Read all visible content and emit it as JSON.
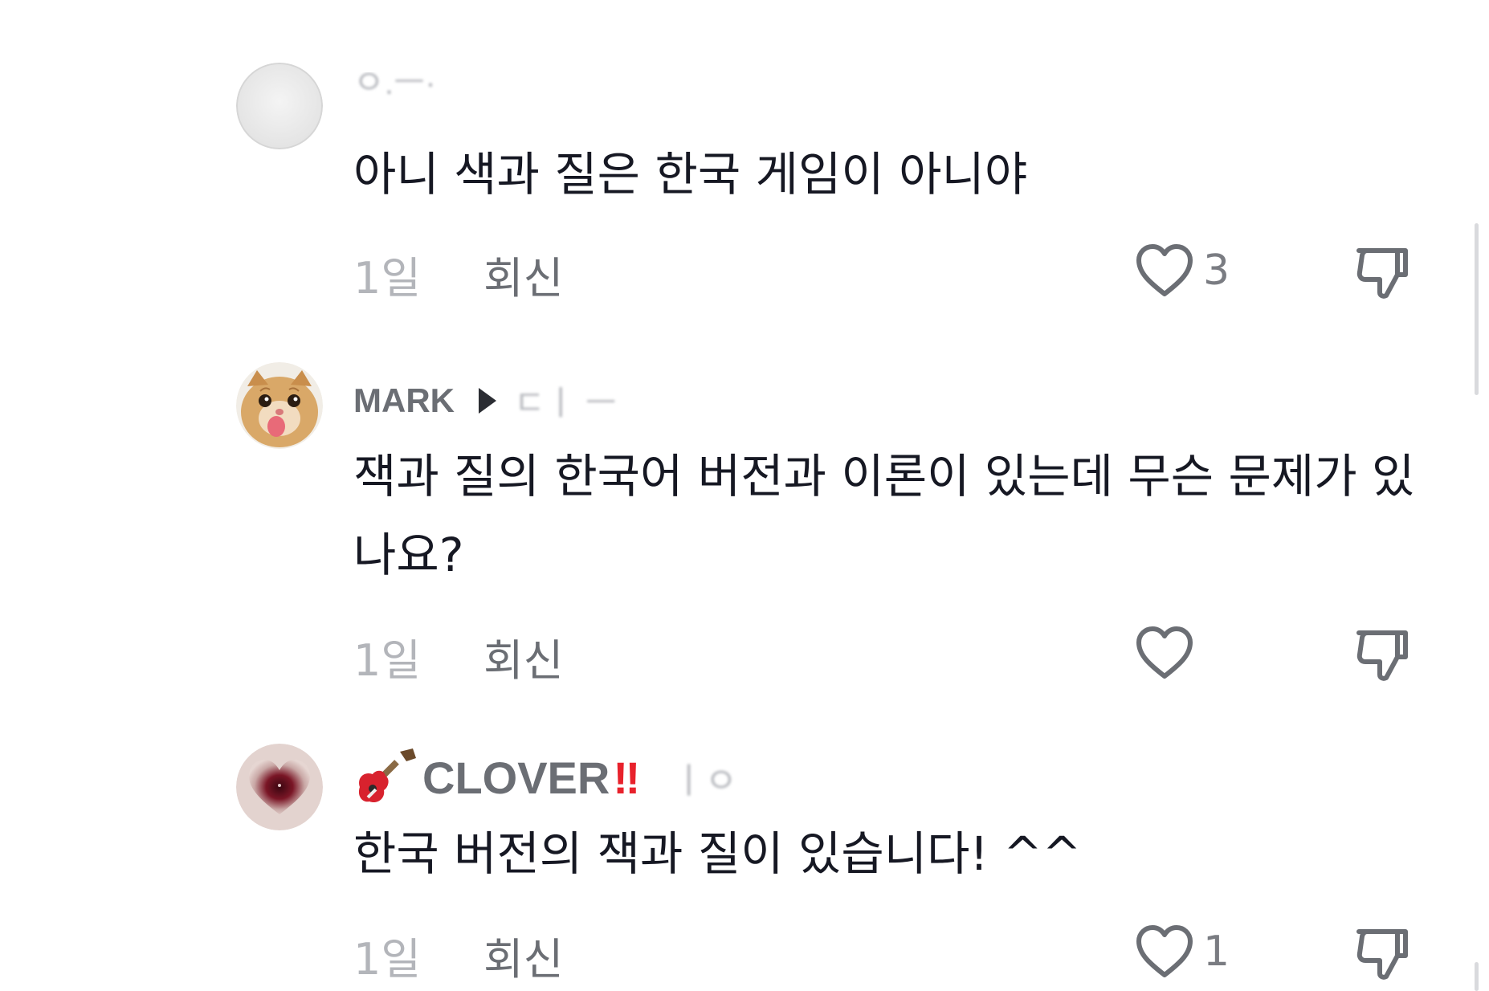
{
  "comments": [
    {
      "username": "ㅇ.ㅡ·",
      "username_suffix": "",
      "text": "아니 색과 질은 한국 게임이 아니야",
      "time": "1일",
      "reply_label": "회신",
      "likes": "3",
      "avatar": "blank-avatar"
    },
    {
      "username": "MARK",
      "username_suffix": "ㄷㅣ ㅡ",
      "text": "잭과 질의 한국어 버전과 이론이 있는데 무슨 문제가 있나요?",
      "time": "1일",
      "reply_label": "회신",
      "likes": "",
      "avatar": "cat-avatar"
    },
    {
      "username": "CLOVER",
      "username_emoji": "‼",
      "username_suffix": "ㅣㅇ",
      "text": "한국 버전의 잭과 질이 있습니다! ^^",
      "time": "1일",
      "reply_label": "회신",
      "likes": "1",
      "avatar": "heart-avatar"
    }
  ],
  "colors": {
    "text": "#161823",
    "muted": "#b3b5ba",
    "secondary": "#6b6e74",
    "icon": "#6b6e74"
  }
}
